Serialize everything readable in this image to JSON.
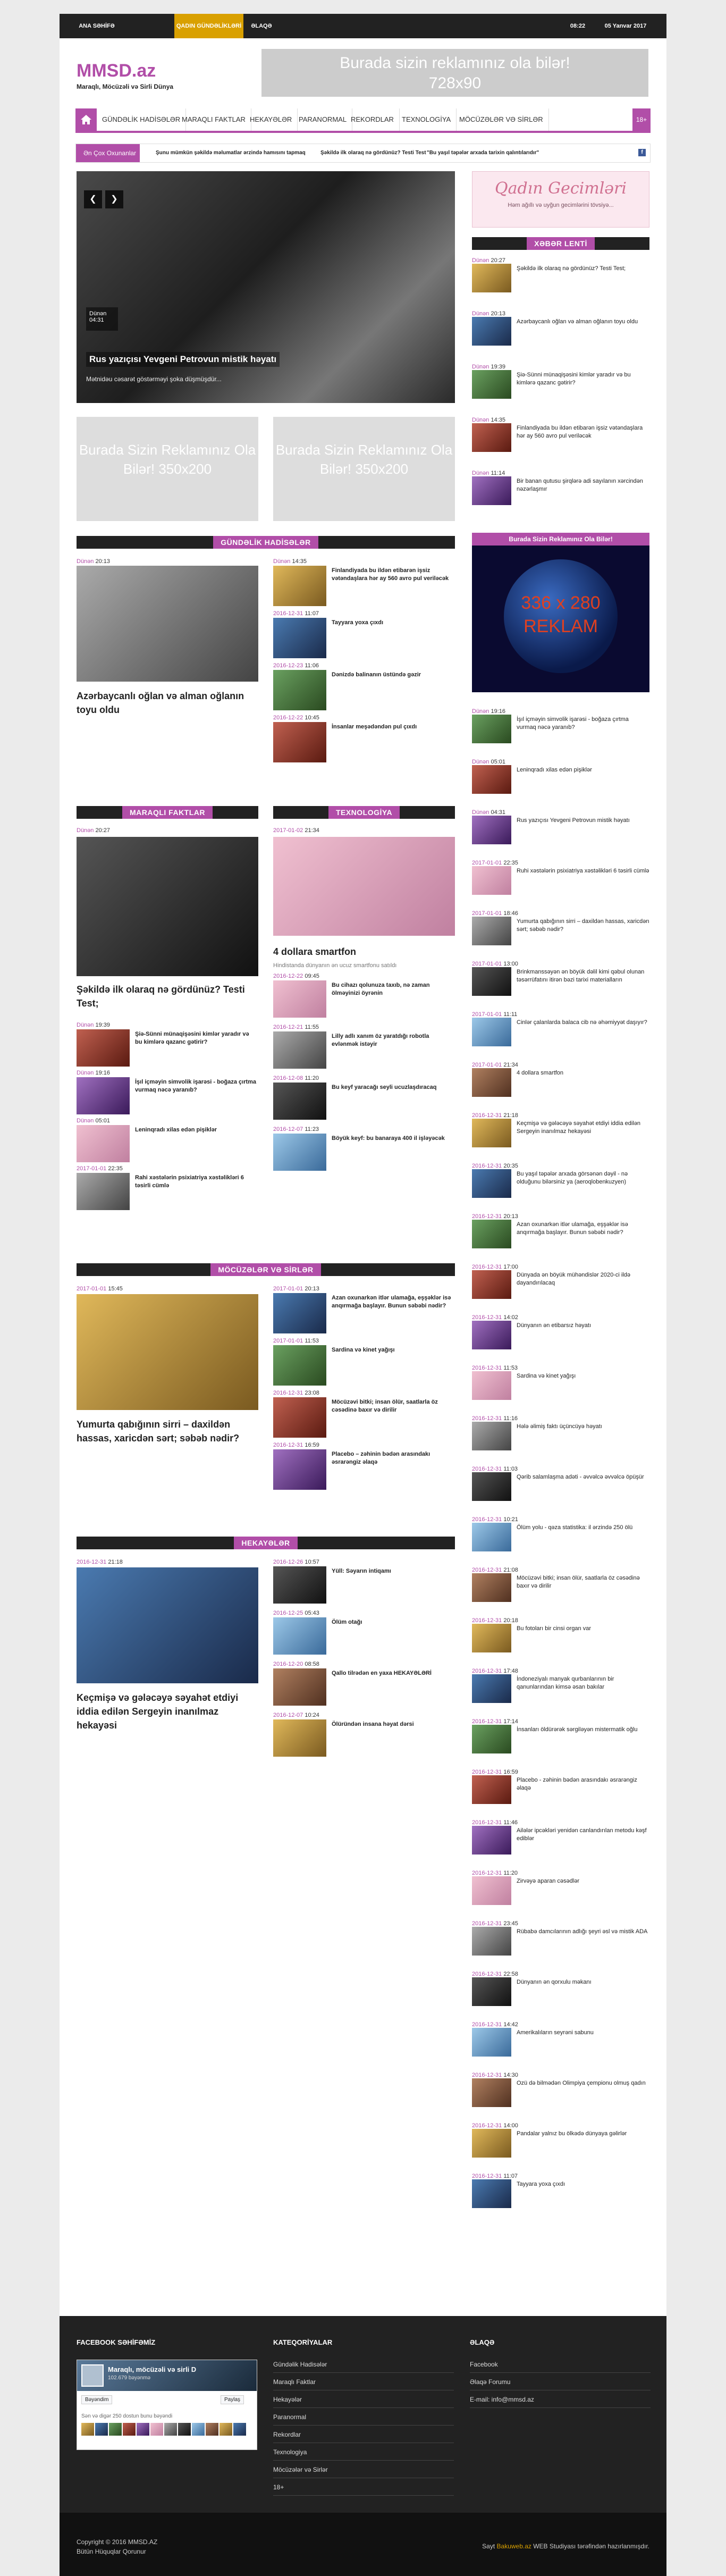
{
  "topbar": {
    "home": "ANA SƏHİFƏ",
    "women": "QADIN GÜNDƏLİKLƏRİ",
    "contact": "ƏLAQƏ",
    "time": "08:22",
    "date": "05 Yanvar 2017"
  },
  "logo": {
    "text": "MMSD.az",
    "slogan": "Maraqlı, Möcüzəli və Sirli Dünya"
  },
  "banner": {
    "line1": "Burada sizin reklamınız ola bilər!",
    "line2": "728x90"
  },
  "nav": {
    "items": [
      "GÜNDƏLİK HADİSƏLƏR",
      "MARAQLI FAKTLAR",
      "HEKAYƏLƏR",
      "PARANORMAL",
      "REKORDLAR",
      "TEXNOLOGİYA",
      "MÖCÜZƏLƏR VƏ SİRLƏR"
    ],
    "last": "18+"
  },
  "ticker": {
    "label": "Ən Çox Oxunanlar",
    "items": [
      "Şunu mümkün şəkildə məlumatlar ərzində hamısını tapmaq",
      "Şəkildə ilk olaraq nə gördünüz? Testi Test",
      "Yanaqlar üçün biz nələr ilə müdaxilə edir",
      "\"Bu yaşıl təpələr arxada tarixin qalıntılarıdır\""
    ]
  },
  "slider": {
    "date": "Dünən",
    "time": "04:31",
    "title": "Rus yazıçısı Yevgeni Petrovun mistik həyatı",
    "excerpt": "Mətnidəu cəsarət göstərməyi şoka düşmüşdür..."
  },
  "ads": {
    "a1": "Burada Sizin Reklamınız Ola Bilər! 350x200",
    "a2": "Burada Sizin Reklamınız Ola Bilər! 350x200"
  },
  "sections": {
    "daily": {
      "title": "GÜNDƏLİK HADİSƏLƏR",
      "main_date": "Dünən",
      "main_time": "20:13",
      "main_title": "Azərbaycanlı oğlan və alman oğlanın toyu oldu",
      "items": [
        {
          "date": "Dünən",
          "time": "14:35",
          "title": "Finlandiyada bu ildən etibarən işsiz vətəndaşlara hər ay 560 avro pul veriləcək"
        },
        {
          "date": "2016-12-31",
          "time": "11:07",
          "title": "Tayyara yoxa çıxdı"
        },
        {
          "date": "2016-12-23",
          "time": "11:06",
          "title": "Dənizdə balinanın üstündə gəzir"
        },
        {
          "date": "2016-12-22",
          "time": "10:45",
          "title": "İnsanlar meşədəndən pul çıxdı"
        }
      ]
    },
    "facts": {
      "title": "MARAQLI FAKTLAR",
      "main_date": "Dünən",
      "main_time": "20:27",
      "main_title": "Şəkildə ilk olaraq nə gördünüz? Testi Test;",
      "items": [
        {
          "date": "Dünən",
          "time": "19:39",
          "title": "Şiə-Sünni münaqişəsini kimlər yaradır və bu kimlərə qazanc gətirir?"
        },
        {
          "date": "Dünən",
          "time": "19:16",
          "title": "İşıl içməyin simvolik işarəsi - boğaza çırtma vurmaq nəcə yaranıb?"
        },
        {
          "date": "Dünən",
          "time": "05:01",
          "title": "Leninqradı xilas edən pişiklər"
        },
        {
          "date": "2017-01-01",
          "time": "22:35",
          "title": "Rahi xəstələrin psixiatriya xəstəlikləri 6 təsirli cümlə"
        }
      ]
    },
    "tech": {
      "title": "TEXNOLOGİYA",
      "main_date": "2017-01-02",
      "main_time": "21:34",
      "main_title": "4 dollara smartfon",
      "excerpt": "Hindistanda dünyanın ən ucuz smartfonu satıldı",
      "items": [
        {
          "date": "2016-12-22",
          "time": "09:45",
          "title": "Bu cihazı qolunuza taxıb, nə zaman ölməyinizi öyrənin"
        },
        {
          "date": "2016-12-21",
          "time": "11:55",
          "title": "Lilly adlı xanım öz yaratdığı robotla evlənmək istəyir"
        },
        {
          "date": "2016-12-08",
          "time": "11:20",
          "title": "Bu keyf yaracağı seyli ucuzlaşdıracaq"
        },
        {
          "date": "2016-12-07",
          "time": "11:23",
          "title": "Böyük keyf: bu banaraya 400 il işləyəcək"
        }
      ]
    },
    "miracles": {
      "title": "MÖCÜZƏLƏR VƏ SİRLƏR",
      "main_date": "2017-01-01",
      "main_time": "15:45",
      "main_title": "Yumurta qabığının sirri – daxildən hassas, xaricdən sərt; səbəb nədir?",
      "items": [
        {
          "date": "2017-01-01",
          "time": "20:13",
          "title": "Azan oxunarkən itlər ulamağa, eşşəklər isə anqırmağa başlayır. Bunun səbəbi nədir?"
        },
        {
          "date": "2017-01-01",
          "time": "11:53",
          "title": "Sardina və kinet yağışı"
        },
        {
          "date": "2016-12-31",
          "time": "23:08",
          "title": "Möcüzəvi bitki; insan ölür, saatlarla öz cəsədinə baxır və dirilir"
        },
        {
          "date": "2016-12-31",
          "time": "16:59",
          "title": "Placebo – zəhinin bədən arasındakı əsrarəngiz əlaqə"
        }
      ]
    },
    "stories": {
      "title": "HEKAYƏLƏR",
      "main_date": "2016-12-31",
      "main_time": "21:18",
      "main_title": "Keçmişə və gələcəyə səyahət etdiyi iddia edilən Sergeyin inanılmaz hekayəsi",
      "items": [
        {
          "date": "2016-12-26",
          "time": "10:57",
          "title": "Yüll: Səyarın intiqamı"
        },
        {
          "date": "2016-12-25",
          "time": "05:43",
          "title": "Ölüm otağı"
        },
        {
          "date": "2016-12-20",
          "time": "08:58",
          "title": "Qallo tilrədən en yaxa HEKAYƏLƏRİ"
        },
        {
          "date": "2016-12-07",
          "time": "10:24",
          "title": "Ölüründən insana həyat dərsi"
        }
      ]
    }
  },
  "sidebar": {
    "qadin": {
      "title": "Qadın Gecimləri",
      "sub": "Həm ağıllı və uyğun gecimlərini tövsiyə..."
    },
    "latest_title": "XƏBƏR LENTİ",
    "latest1": [
      {
        "date": "Dünən",
        "time": "20:27",
        "title": "Şəkildə ilk olaraq nə gördünüz? Testi Test;"
      },
      {
        "date": "Dünən",
        "time": "20:13",
        "title": "Azərbaycanlı oğlan və alman oğlanın toyu oldu"
      },
      {
        "date": "Dünən",
        "time": "19:39",
        "title": "Şiə-Sünni münaqişəsini kimlər yaradır və bu kimlərə qazanc gətirir?"
      },
      {
        "date": "Dünən",
        "time": "14:35",
        "title": "Finlandiyada bu ildən etibarən işsiz vətəndaşlara hər ay 560 avro pul veriləcək"
      },
      {
        "date": "Dünən",
        "time": "11:14",
        "title": "Bir banan qutusu şirqlərə adi sayılanın xərcindən nəzərlaşmır"
      }
    ],
    "ad_title": "Burada Sizin Reklamınız Ola Bilər!",
    "ad_line1": "336 x 280",
    "ad_line2": "REKLAM",
    "latest2": [
      {
        "date": "Dünən",
        "time": "19:16",
        "title": "İşıl içməyin simvolik işarəsi - boğaza çırtma vurmaq nəcə yaranıb?"
      },
      {
        "date": "Dünən",
        "time": "05:01",
        "title": "Leninqradı xilas edən pişiklər"
      },
      {
        "date": "Dünən",
        "time": "04:31",
        "title": "Rus yazıçısı Yevgeni Petrovun mistik həyatı"
      },
      {
        "date": "2017-01-01",
        "time": "22:35",
        "title": "Ruhi xəstələrin psixiatriya xəstəlikləri 6 təsirli cümlə"
      },
      {
        "date": "2017-01-01",
        "time": "18:46",
        "title": "Yumurta qabığının sirri – daxildən hassas, xaricdən sərt; səbəb nədir?"
      },
      {
        "date": "2017-01-01",
        "time": "13:00",
        "title": "Brinkmanssəyən ən böyük dəlil kimi qəbul olunan təsərrüfatını itirən bəzi tarixi materialların"
      },
      {
        "date": "2017-01-01",
        "time": "11:11",
        "title": "Cinlər çalanlarda balaca cib nə əhəmiyyət daşıyır?"
      },
      {
        "date": "2017-01-01",
        "time": "21:34",
        "title": "4 dollara smartfon"
      },
      {
        "date": "2016-12-31",
        "time": "21:18",
        "title": "Keçmişə və gələcəyə səyahət etdiyi iddia edilən Sergeyin inanılmaz hekayəsi"
      },
      {
        "date": "2016-12-31",
        "time": "20:35",
        "title": "Bu yaşıl təpələr arxada görsənən dəyil - nə olduğunu bilərsiniz ya (aeroqlobenkuzyen)"
      },
      {
        "date": "2016-12-31",
        "time": "20:13",
        "title": "Azan oxunarkən itlər ulamağa, eşşəklər isə anqırmağa başlayır. Bunun səbəbi nədir?"
      },
      {
        "date": "2016-12-31",
        "time": "17:00",
        "title": "Dünyada ən böyük mühəndislər 2020-ci ildə dayandırılacaq"
      },
      {
        "date": "2016-12-31",
        "time": "14:02",
        "title": "Dünyanın ən etibarsız həyatı"
      },
      {
        "date": "2016-12-31",
        "time": "11:53",
        "title": "Sardina və kinet yağışı"
      },
      {
        "date": "2016-12-31",
        "time": "11:16",
        "title": "Hələ əlimiş faktı üçüncüyə həyatı"
      },
      {
        "date": "2016-12-31",
        "time": "11:03",
        "title": "Qərib salamlaşma adəti - əvvəlcə əvvəlcə öpüşür"
      },
      {
        "date": "2016-12-31",
        "time": "10:21",
        "title": "Ölüm yolu - qəza statistika: il ərzində 250 ölü"
      },
      {
        "date": "2016-12-31",
        "time": "21:08",
        "title": "Möcüzəvi bitki; insan ölür, saatlarla öz cəsədinə baxır və dirilir"
      },
      {
        "date": "2016-12-31",
        "time": "20:18",
        "title": "Bu fotoları bir cinsi organ var"
      },
      {
        "date": "2016-12-31",
        "time": "17:48",
        "title": "İndoneziyalı manyak qurbanlarının bir qanunlarından kimsə əsan bakılar"
      },
      {
        "date": "2016-12-31",
        "time": "17:14",
        "title": "İnsanları öldürərək sərgiləyən mistermatik oğlu"
      },
      {
        "date": "2016-12-31",
        "time": "16:59",
        "title": "Placebo - zəhinin bədən arasındakı əsrarəngiz əlaqə"
      },
      {
        "date": "2016-12-31",
        "time": "11:46",
        "title": "Ailələr ipcəkləri yenidən canlandırılan metodu kəşf ediblər"
      },
      {
        "date": "2016-12-31",
        "time": "11:20",
        "title": "Zirvəyə aparan cəsədlər"
      },
      {
        "date": "2016-12-31",
        "time": "23:45",
        "title": "Rübabə damcılarının adlığı şeyri əsl və mistik ADA"
      },
      {
        "date": "2016-12-31",
        "time": "22:58",
        "title": "Dünyanın ən qorxulu məkanı"
      },
      {
        "date": "2016-12-31",
        "time": "14:42",
        "title": "Amerikalıların seyrəni sabunu"
      },
      {
        "date": "2016-12-31",
        "time": "14:30",
        "title": "Ozü də bilmədən Olimpiya çempionu olmuş qadın"
      },
      {
        "date": "2016-12-31",
        "time": "14:00",
        "title": "Pandalar yalnız bu ölkədə dünyaya gəlirlər"
      },
      {
        "date": "2016-12-31",
        "time": "11:07",
        "title": "Tayyara yoxa çıxdı"
      }
    ]
  },
  "footer": {
    "fb_title": "FACEBOOK SƏHİFƏMİZ",
    "fb_page": "Maraqlı, möcüzəli və sirli D",
    "fb_likes": "102.679 bəyənmə",
    "fb_like_btn": "Bəyəndim",
    "fb_share_btn": "Paylaş",
    "fb_friends": "Sən və digər 250 dostun bunu bəyəndi",
    "cat_title": "KATEQORİYALAR",
    "cats": [
      "Gündəlik Hadisələr",
      "Maraqlı Faktlar",
      "Hekayələr",
      "Paranormal",
      "Rekordlar",
      "Texnologiya",
      "Möcüzələr və Sirlər",
      "18+"
    ],
    "contact_title": "ƏLAQƏ",
    "contacts": [
      "Facebook",
      "Əlaqə Forumu",
      "E-mail: info@mmsd.az"
    ]
  },
  "bottom": {
    "copyright": "Copyright © 2016 MMSD.AZ",
    "rights": "Bütün Hüquqlar Qorunur",
    "credit_pre": "Sayt ",
    "credit_brand": "Bakuweb.az",
    "credit_post": " WEB Studiyası tərəfindən hazırlanmışdır."
  }
}
